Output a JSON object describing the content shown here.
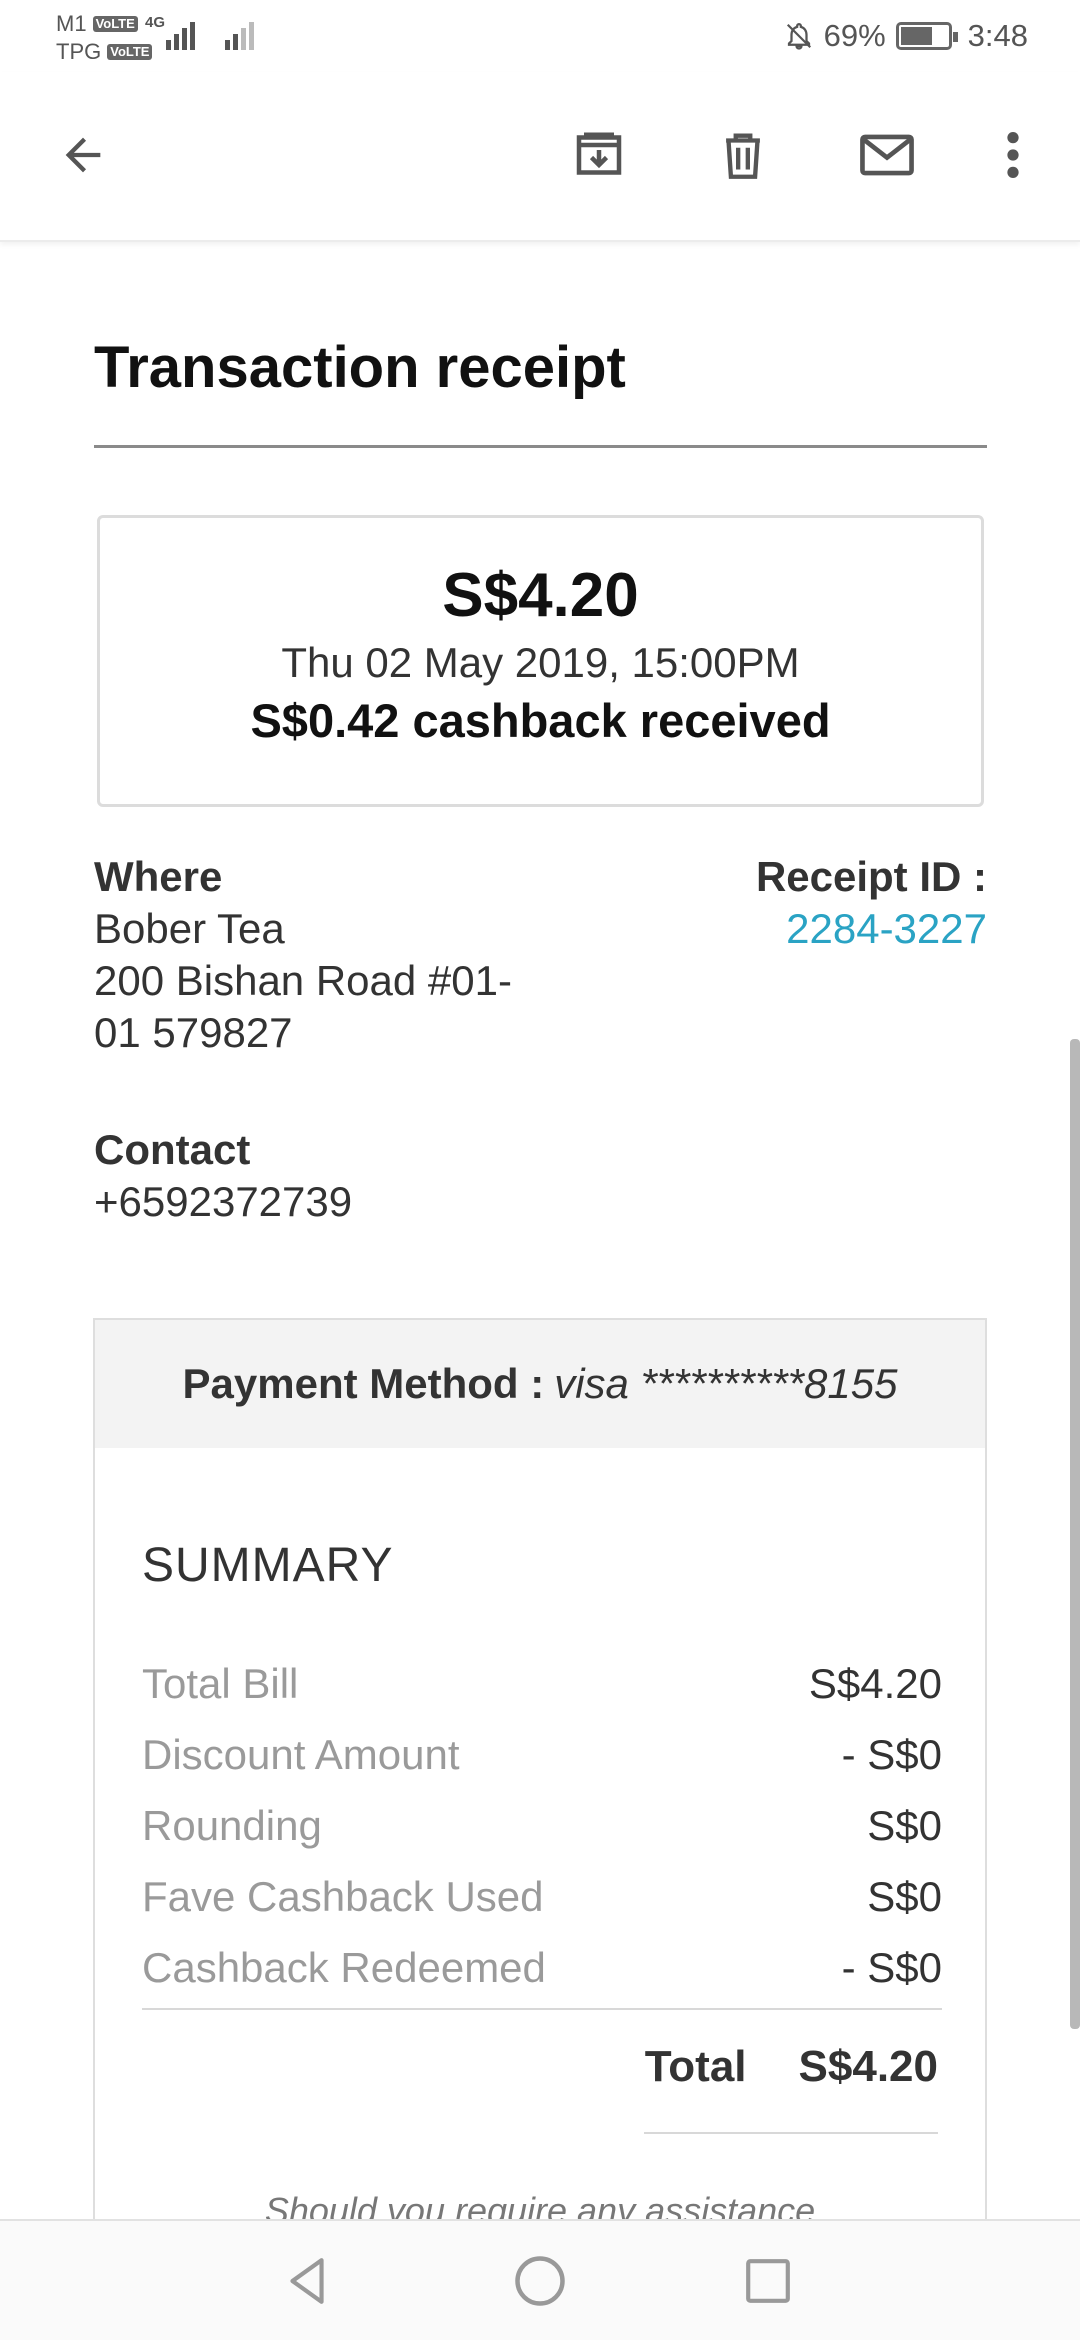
{
  "status_bar": {
    "carrier_1": "M1",
    "carrier_2": "TPG",
    "volte": "VoLTE",
    "network": "4G",
    "battery": "69%",
    "time": "3:48"
  },
  "toolbar": {
    "icons": [
      "back-arrow-icon",
      "archive-icon",
      "delete-icon",
      "mail-icon",
      "more-vert-icon"
    ]
  },
  "receipt": {
    "title": "Transaction receipt",
    "amount": "S$4.20",
    "date": "Thu 02 May 2019, 15:00PM",
    "cashback": "S$0.42 cashback received",
    "where_label": "Where",
    "merchant": "Bober Tea",
    "address_line1": "200 Bishan Road #01-",
    "address_line2": "01 579827",
    "receipt_id_label": "Receipt ID :",
    "receipt_id": "2284-3227",
    "contact_label": "Contact",
    "contact": "+6592372739"
  },
  "payment": {
    "label": "Payment Method :",
    "value": "visa **********8155"
  },
  "summary": {
    "title": "SUMMARY",
    "rows": [
      {
        "label": "Total Bill",
        "value": "S$4.20"
      },
      {
        "label": "Discount Amount",
        "value": "- S$0"
      },
      {
        "label": "Rounding",
        "value": "S$0"
      },
      {
        "label": "Fave Cashback Used",
        "value": "S$0"
      },
      {
        "label": "Cashback Redeemed",
        "value": "- S$0"
      }
    ],
    "total_label": "Total",
    "total_value": "S$4.20",
    "assistance": "Should you require any assistance"
  },
  "colors": {
    "link": "#2aa3c4",
    "muted": "#9a9a9a"
  }
}
